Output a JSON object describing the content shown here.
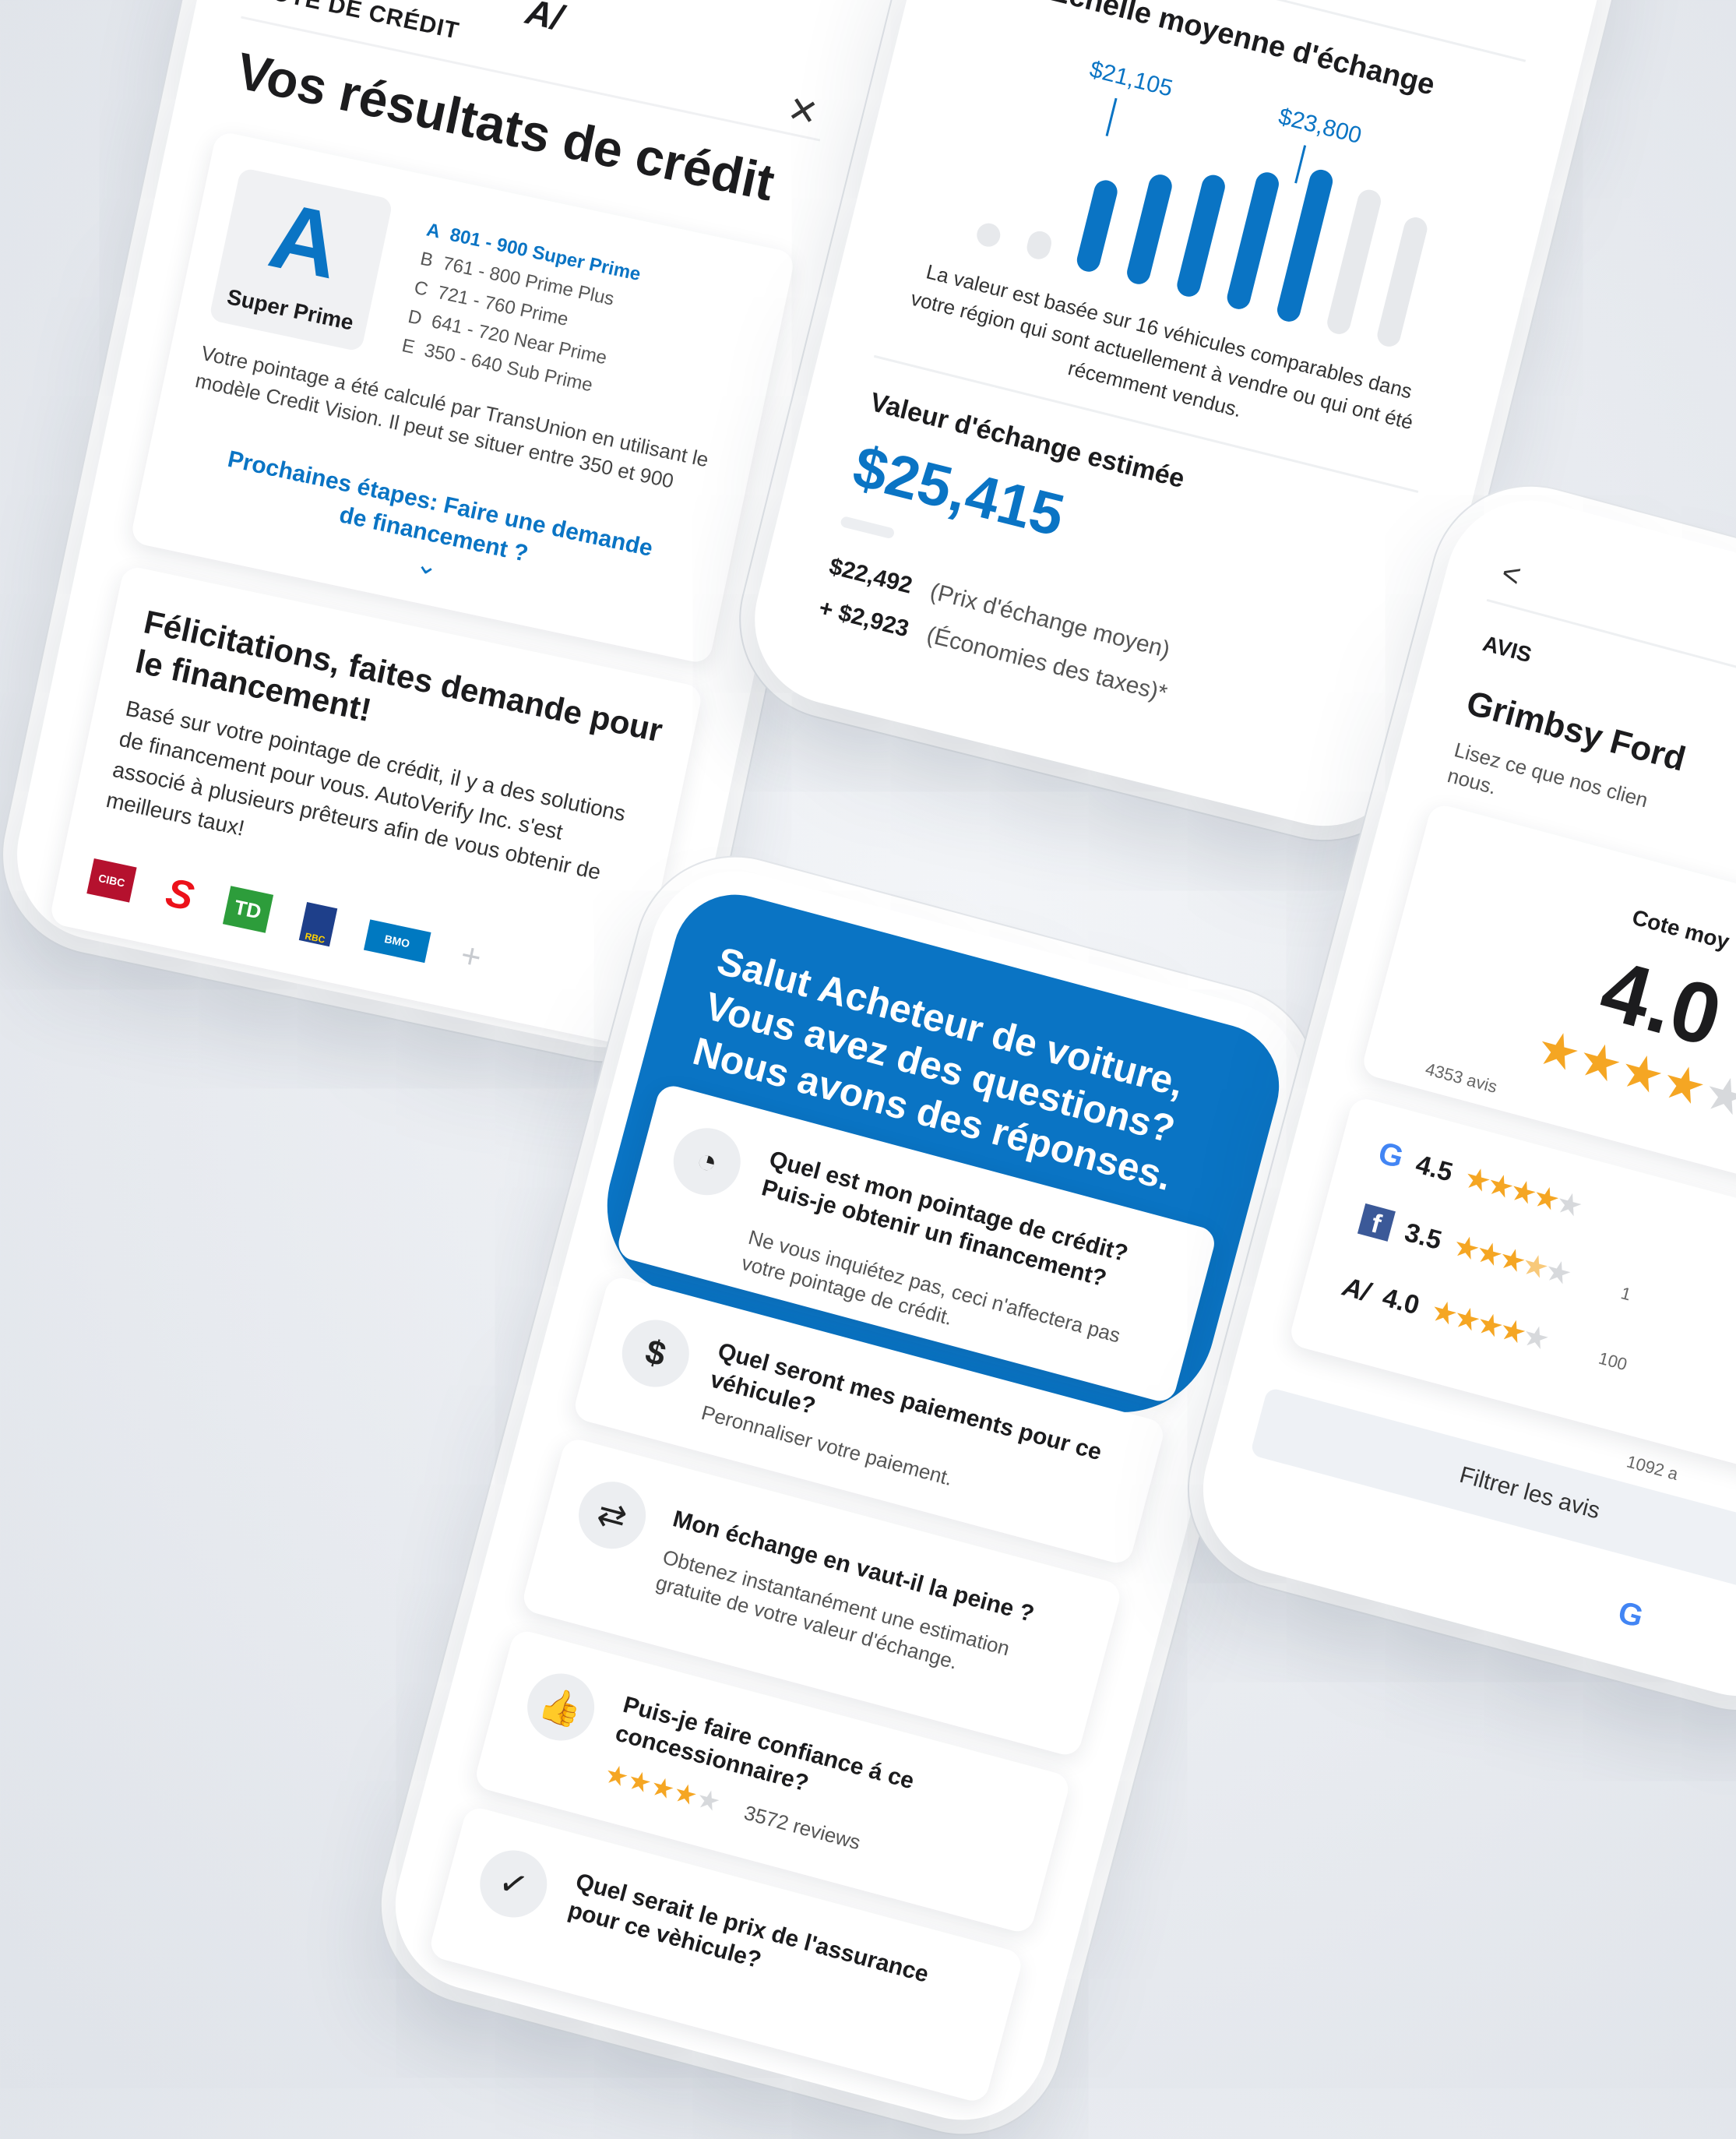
{
  "credit": {
    "brand_mark": "A/",
    "section_label": "COTE DE CRÉDIT",
    "title": "Vos résultats de crédit",
    "grade_letter": "A",
    "grade_name": "Super Prime",
    "tiers": [
      {
        "letter": "A",
        "range": "801 - 900 Super Prime",
        "active": true
      },
      {
        "letter": "B",
        "range": "761 - 800 Prime Plus",
        "active": false
      },
      {
        "letter": "C",
        "range": "721 - 760 Prime",
        "active": false
      },
      {
        "letter": "D",
        "range": "641 - 720 Near Prime",
        "active": false
      },
      {
        "letter": "E",
        "range": "350 - 640 Sub Prime",
        "active": false
      }
    ],
    "explanation": "Votre pointage a été calculé par TransUnion en utilisant le modèle Credit Vision. Il peut se situer entre 350 et 900",
    "next_steps_link": "Prochaines étapes: Faire une demande de financement ?",
    "congrats_title": "Félicitations, faites demande pour le financement!",
    "congrats_body": "Basé sur votre pointage de crédit, il y a des solutions de financement pour vous. AutoVerify Inc. s'est associé à plusieurs prêteurs afin de vous obtenir de meilleurs taux!",
    "banks": [
      {
        "name": "CIBC",
        "color": "#b5112e"
      },
      {
        "name": "S",
        "color": "#ec111a"
      },
      {
        "name": "TD",
        "color": "#2d9d3b"
      },
      {
        "name": "RBC",
        "color": "#1e3f8a"
      },
      {
        "name": "BMO",
        "color": "#0079c1"
      }
    ],
    "more_label": "+"
  },
  "trade": {
    "range_title": "Échelle moyenne d'échange",
    "low_label": "$21,105",
    "high_label": "$23,800",
    "bars": [
      0.12,
      0.18,
      0.6,
      0.72,
      0.8,
      0.9,
      1.0,
      0.95,
      0.85
    ],
    "active_bars": [
      2,
      3,
      4,
      5,
      6
    ],
    "basis_text": "La valeur est basée sur 16 véhicules comparables dans votre région qui sont actuellement à vendre ou qui ont été récemment vendus.",
    "estimated_title": "Valeur d'échange estimée",
    "estimated_value": "$25,415",
    "avg_amount": "$22,492",
    "avg_label": "(Prix d'échange moyen)",
    "tax_amount": "+ $2,923",
    "tax_label": "(Économies des taxes)*"
  },
  "faq": {
    "header_line1": "Salut Acheteur de voiture,",
    "header_line2": "Vous avez des questions?",
    "header_line3": "Nous avons des réponses.",
    "items": [
      {
        "icon": "gauge-icon",
        "glyph": "◔",
        "title": "Quel est mon pointage de crédit? Puis-je obtenir un financement?",
        "subtitle": "Ne vous inquiétez pas, ceci n'affectera pas votre pointage de crédit."
      },
      {
        "icon": "dollar-icon",
        "glyph": "$",
        "title": "Quel seront mes paiements pour ce véhicule?",
        "subtitle": "Peronnaliser votre paiement."
      },
      {
        "icon": "swap-icon",
        "glyph": "⇄",
        "title": "Mon échange en vaut-il la peine ?",
        "subtitle": "Obtenez instantanément une estimation gratuite de votre valeur d'échange."
      },
      {
        "icon": "thumbs-up-icon",
        "glyph": "👍",
        "title": "Puis-je faire confiance á ce concessionnaire?",
        "subtitle": "",
        "rating_stars": 4,
        "rating_count": "3572 reviews"
      },
      {
        "icon": "shield-check-icon",
        "glyph": "✓",
        "title": "Quel serait le prix de l'assurance pour ce vèhicule?",
        "subtitle": ""
      }
    ]
  },
  "reviews": {
    "back_label": "<",
    "section_label": "AVIS",
    "dealer_name": "Grimbsy Ford",
    "intro": "Lisez ce que nos clien nous.",
    "avg_label": "Cote moy",
    "avg_value": "4.0",
    "avg_stars": 4,
    "total_reviews": "4353 avis",
    "sources": [
      {
        "icon": "google-icon",
        "glyph": "G",
        "color": "#4285f4",
        "score": "4.5",
        "stars": 4,
        "count": ""
      },
      {
        "icon": "facebook-icon",
        "glyph": "f",
        "color": "#3b5998",
        "score": "3.5",
        "stars": 3,
        "count": "1"
      },
      {
        "icon": "autoverify-icon",
        "glyph": "A/",
        "color": "#111111",
        "score": "4.0",
        "stars": 4,
        "count": "100"
      }
    ],
    "last_count": "1092 a",
    "filter_label": "Filtrer les avis",
    "footer_glyph": "G"
  }
}
